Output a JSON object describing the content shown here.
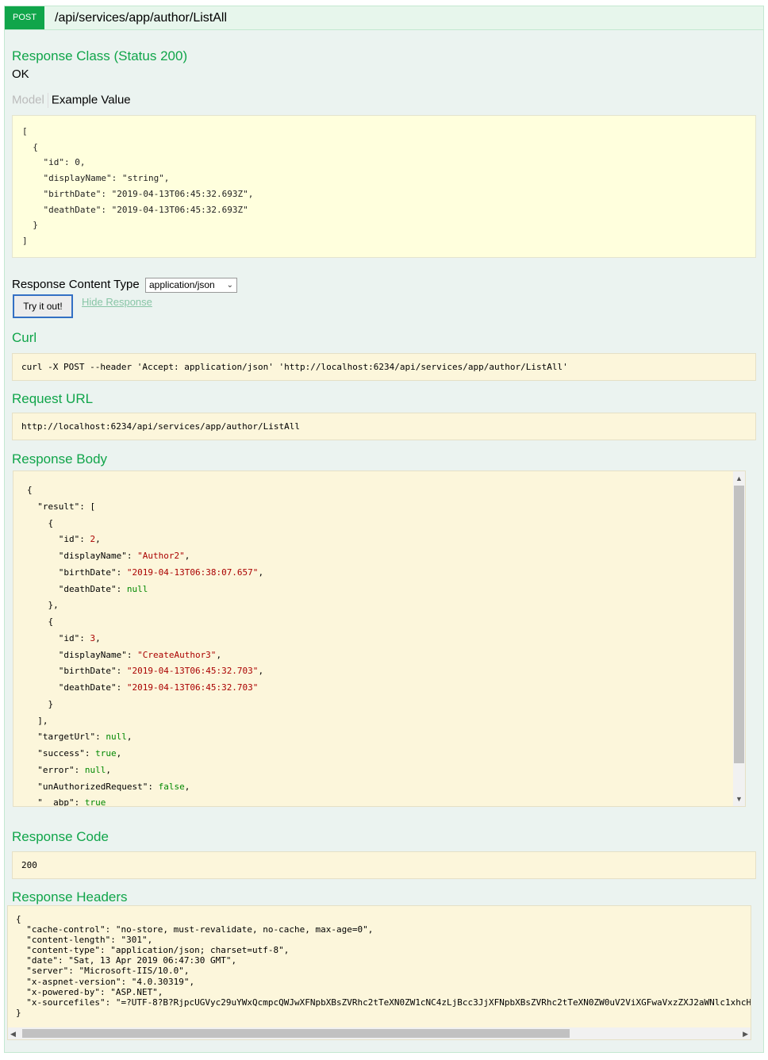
{
  "operation": {
    "method": "POST",
    "path": "/api/services/app/author/ListAll"
  },
  "response_class": {
    "title": "Response Class (Status 200)",
    "status_text": "OK"
  },
  "model_tabs": {
    "model": "Model",
    "example": "Example Value"
  },
  "example_value": "[\n  {\n    \"id\": 0,\n    \"displayName\": \"string\",\n    \"birthDate\": \"2019-04-13T06:45:32.693Z\",\n    \"deathDate\": \"2019-04-13T06:45:32.693Z\"\n  }\n]",
  "content_type": {
    "label": "Response Content Type",
    "selected": "application/json"
  },
  "actions": {
    "try_label": "Try it out!",
    "hide_label": "Hide Response"
  },
  "curl": {
    "title": "Curl",
    "command": "curl -X POST --header 'Accept: application/json' 'http://localhost:6234/api/services/app/author/ListAll'"
  },
  "request_url": {
    "title": "Request URL",
    "url": "http://localhost:6234/api/services/app/author/ListAll"
  },
  "response_body": {
    "title": "Response Body"
  },
  "response_code": {
    "title": "Response Code",
    "code": "200"
  },
  "response_headers": {
    "title": "Response Headers",
    "text": "{\n  \"cache-control\": \"no-store, must-revalidate, no-cache, max-age=0\",\n  \"content-length\": \"301\",\n  \"content-type\": \"application/json; charset=utf-8\",\n  \"date\": \"Sat, 13 Apr 2019 06:47:30 GMT\",\n  \"server\": \"Microsoft-IIS/10.0\",\n  \"x-aspnet-version\": \"4.0.30319\",\n  \"x-powered-by\": \"ASP.NET\",\n  \"x-sourcefiles\": \"=?UTF-8?B?RjpcUGVyc29uYWxQcmpcQWJwXFNpbXBsZVRhc2tTeXN0ZW1cNC4zLjBcc3JjXFNpbXBsZVRhc2tTeXN0ZW0uV2ViXGFwaVxzZXJ2aWNlc1xhcHBcYXV0aG9yXExpc3RBbGw=?=\"\n}"
  },
  "colors": {
    "accent": "#10a54a",
    "method_bg": "#10a54a",
    "block_bg": "#fcf6db",
    "panel_bg": "#ebf3f0"
  }
}
